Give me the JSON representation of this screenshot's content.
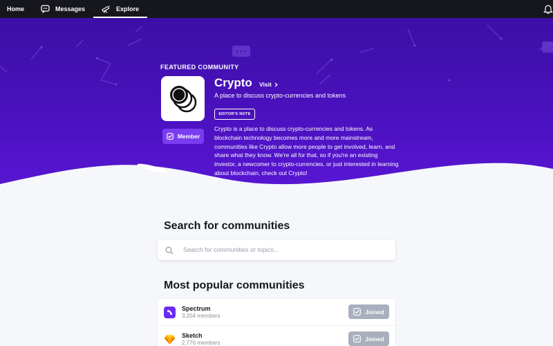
{
  "nav": {
    "items": [
      {
        "label": "Home",
        "icon": "home-icon"
      },
      {
        "label": "Messages",
        "icon": "message-icon"
      },
      {
        "label": "Explore",
        "icon": "telescope-icon",
        "active": true
      }
    ],
    "right_icon": "bell-icon"
  },
  "featured": {
    "kicker": "FEATURED COMMUNITY",
    "name": "Crypto",
    "visit_label": "Visit",
    "tagline": "A place to discuss crypto-currencies and tokens",
    "badge": "EDITOR'S NOTE",
    "description": "Crypto is a place to discuss crypto-currencies and tokens. As blockchain technology becomes more and more mainstream, communities like Crypto allow more people to get involved, learn, and share what they know. We're all for that, so if you're an existing investor, a newcomer to crypto-currencies, or just interested in learning about blockchain, check out Crypto!",
    "member_label": "Member",
    "icon": "coins-icon"
  },
  "search": {
    "title": "Search for communities",
    "placeholder": "Search for communities or topics..."
  },
  "popular": {
    "title": "Most popular communities",
    "communities": [
      {
        "name": "Spectrum",
        "members": "3,204 members",
        "button": "Joined",
        "icon": "spectrum-logo-icon"
      },
      {
        "name": "Sketch",
        "members": "2,776 members",
        "button": "Joined",
        "icon": "sketch-diamond-icon"
      }
    ]
  },
  "colors": {
    "hero_gradient_top": "#3d0fa6",
    "hero_gradient_bottom": "#5a17d6",
    "member_button": "#7a3cf0",
    "joined_button": "#a9afbc",
    "nav_bg": "#16171d"
  }
}
